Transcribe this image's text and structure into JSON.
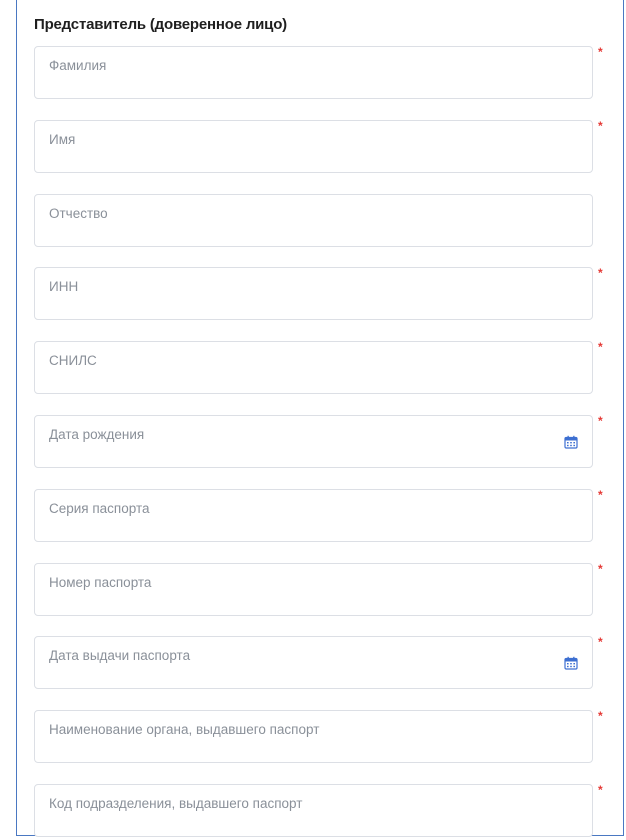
{
  "section": {
    "title": "Представитель (доверенное лицо)"
  },
  "required_mark": "*",
  "fields": [
    {
      "placeholder": "Фамилия",
      "required": true,
      "calendar": false
    },
    {
      "placeholder": "Имя",
      "required": true,
      "calendar": false
    },
    {
      "placeholder": "Отчество",
      "required": false,
      "calendar": false
    },
    {
      "placeholder": "ИНН",
      "required": true,
      "calendar": false
    },
    {
      "placeholder": "СНИЛС",
      "required": true,
      "calendar": false
    },
    {
      "placeholder": "Дата рождения",
      "required": true,
      "calendar": true
    },
    {
      "placeholder": "Серия паспорта",
      "required": true,
      "calendar": false
    },
    {
      "placeholder": "Номер паспорта",
      "required": true,
      "calendar": false
    },
    {
      "placeholder": "Дата выдачи паспорта",
      "required": true,
      "calendar": true
    },
    {
      "placeholder": "Наименование органа, выдавшего паспорт",
      "required": true,
      "calendar": false
    },
    {
      "placeholder": "Код подразделения, выдавшего паспорт",
      "required": true,
      "calendar": false
    }
  ],
  "colors": {
    "required": "#e53935",
    "calendar_icon": "#3d6fd1",
    "frame_border": "#4a78c2",
    "field_border": "#dcdfe5",
    "placeholder": "#8a9099"
  },
  "icons": {
    "date_picker": "calendar-icon"
  }
}
